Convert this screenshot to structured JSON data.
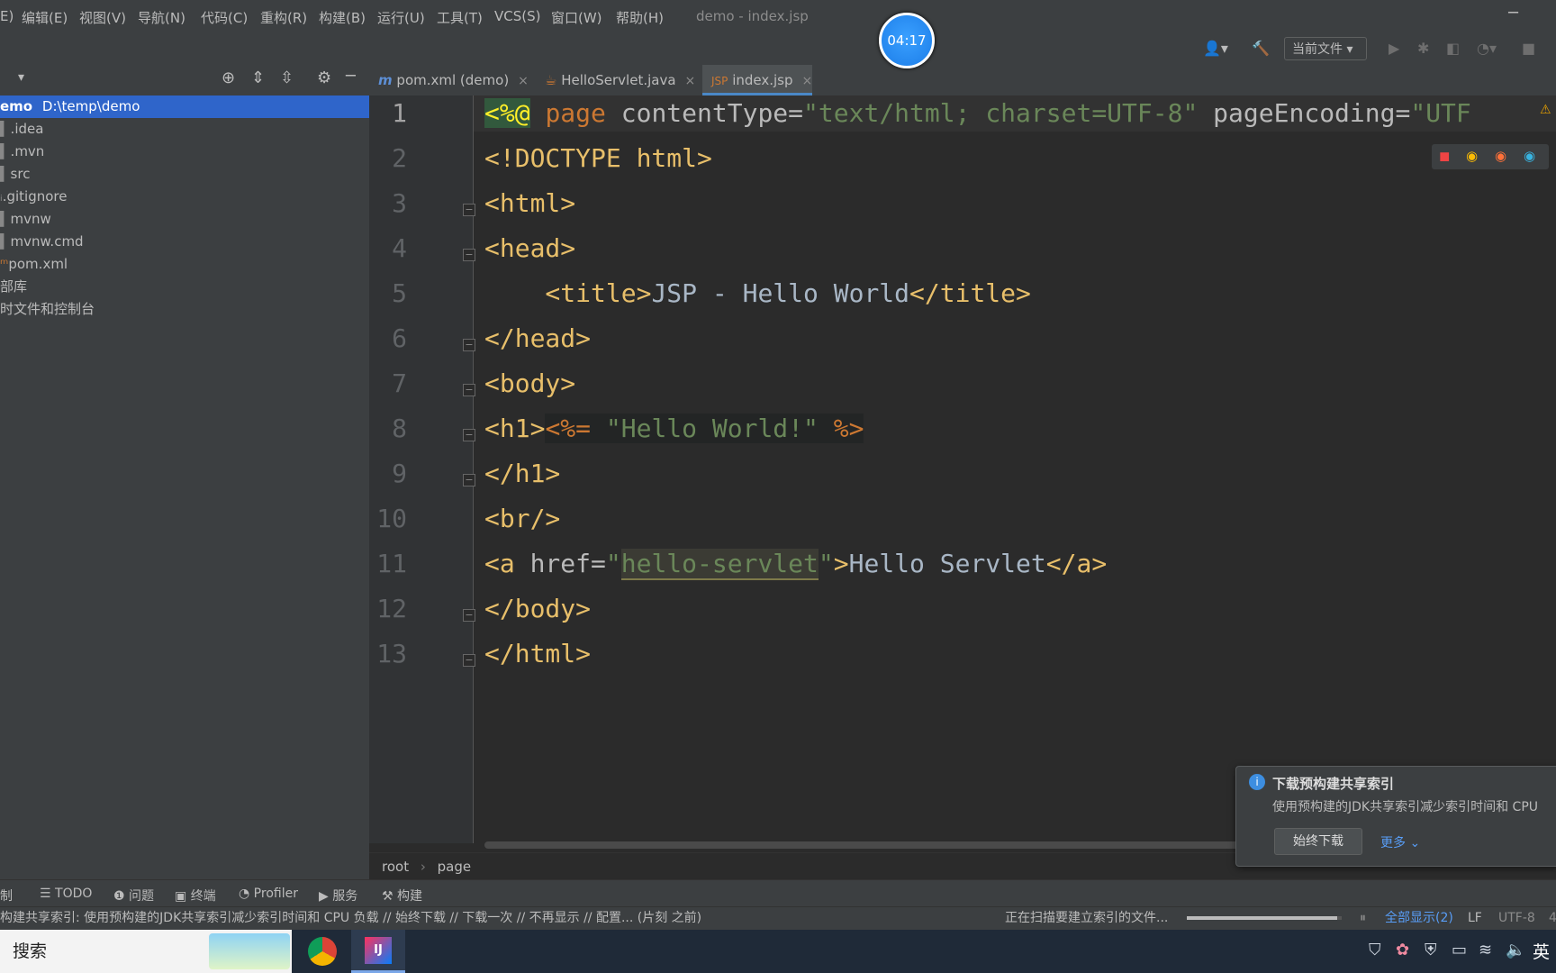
{
  "menu": {
    "items": [
      "E)",
      "编辑(E)",
      "视图(V)",
      "导航(N)",
      "代码(C)",
      "重构(R)",
      "构建(B)",
      "运行(U)",
      "工具(T)",
      "VCS(S)",
      "窗口(W)",
      "帮助(H)"
    ],
    "window_title": "demo - index.jsp",
    "minimize": "─"
  },
  "timer": "04:17",
  "toolbar": {
    "run_config": "当前文件 ▾",
    "icons": [
      "user-icon",
      "hammer-icon",
      "run-icon",
      "debug-icon",
      "coverage-icon",
      "profile-icon",
      "stop-icon"
    ]
  },
  "project": {
    "root_name": "emo",
    "root_path": "D:\\temp\\demo",
    "items": [
      ".idea",
      ".mvn",
      "src",
      ".gitignore",
      "mvnw",
      "mvnw.cmd",
      "pom.xml",
      "部库",
      "时文件和控制台"
    ]
  },
  "tabs": [
    {
      "label": "pom.xml (demo)",
      "icon": "m"
    },
    {
      "label": "HelloServlet.java",
      "icon": "java"
    },
    {
      "label": "index.jsp",
      "icon": "jsp"
    }
  ],
  "editor": {
    "line_numbers": [
      "1",
      "2",
      "3",
      "4",
      "5",
      "6",
      "7",
      "8",
      "9",
      "10",
      "11",
      "12",
      "13"
    ],
    "lines": {
      "l1": {
        "a": "<%@",
        "b": "page",
        "c": " contentType=",
        "d": "\"text/html; charset=UTF-8\"",
        "e": " pageEncoding=",
        "f": "\"UTF"
      },
      "l2": "<!DOCTYPE html>",
      "l3": "<html>",
      "l4": "<head>",
      "l5": {
        "a": "    <title>",
        "b": "JSP - Hello World",
        "c": "</title>"
      },
      "l6": "</head>",
      "l7": "<body>",
      "l8": {
        "a": "<h1>",
        "b": "<%=",
        "c": " \"Hello World!\" ",
        "d": "%>"
      },
      "l9": "</h1>",
      "l10": "<br/>",
      "l11": {
        "a": "<a ",
        "b": "href=",
        "c": "\"",
        "d": "hello-servlet",
        "e": "\"",
        "f": ">",
        "g": "Hello Servlet",
        "h": "</a>"
      },
      "l12": "</body>",
      "l13": "</html>"
    }
  },
  "breadcrumb": {
    "root": "root",
    "sep": "›",
    "page": "page"
  },
  "toolwindows": [
    "制",
    "TODO",
    "问题",
    "终端",
    "Profiler",
    "服务",
    "构建"
  ],
  "status": {
    "message": "构建共享索引: 使用预构建的JDK共享索引减少索引时间和 CPU 负载 // 始终下载 // 下载一次 // 不再显示 // 配置... (片刻 之前)",
    "indexing": "正在扫描要建立索引的文件...",
    "progress": 0.97,
    "show_all": "全部显示(2)",
    "line_sep": "LF",
    "encoding": "UTF-8",
    "extra": "4"
  },
  "notification": {
    "title": "下载预构建共享索引",
    "body": "使用预构建的JDK共享索引减少索引时间和 CPU",
    "button": "始终下载",
    "more": "更多 ⌄"
  },
  "taskbar": {
    "search": "搜索",
    "ime": "英"
  },
  "colors": {
    "editor_bg": "#2b2b2b",
    "panel_bg": "#3c3f41",
    "selection": "#2f65ca",
    "tag": "#e8bf6a",
    "string": "#6a8759",
    "keyword": "#cc7832"
  }
}
